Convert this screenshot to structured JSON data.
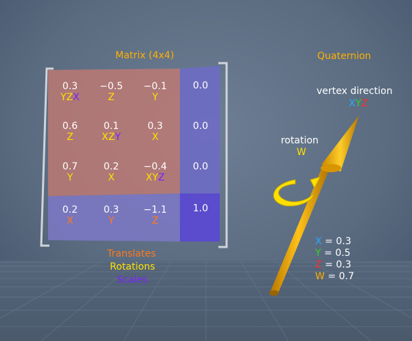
{
  "colors": {
    "x": "#ff7a1a",
    "y": "#ffe000",
    "z": "#7a22ff",
    "gold": "#ffb000",
    "cyan_x": "#2aa8ff",
    "green_y": "#36d12a",
    "red_z": "#ff2a2a"
  },
  "matrix": {
    "title": "Matrix (4x4)",
    "rows": [
      [
        {
          "value": "0.3",
          "axes": [
            {
              "t": "YZ",
              "c": "y"
            },
            {
              "t": "X",
              "c": "z"
            }
          ]
        },
        {
          "value": "−0.5",
          "axes": [
            {
              "t": "Z",
              "c": "y"
            }
          ]
        },
        {
          "value": "−0.1",
          "axes": [
            {
              "t": "Y",
              "c": "y"
            }
          ]
        }
      ],
      [
        {
          "value": "0.6",
          "axes": [
            {
              "t": "Z",
              "c": "y"
            }
          ]
        },
        {
          "value": "0.1",
          "axes": [
            {
              "t": "XZ",
              "c": "y"
            },
            {
              "t": "Y",
              "c": "z"
            }
          ]
        },
        {
          "value": "0.3",
          "axes": [
            {
              "t": "X",
              "c": "y"
            }
          ]
        }
      ],
      [
        {
          "value": "0.7",
          "axes": [
            {
              "t": "Y",
              "c": "y"
            }
          ]
        },
        {
          "value": "0.2",
          "axes": [
            {
              "t": "X",
              "c": "y"
            }
          ]
        },
        {
          "value": "−0.4",
          "axes": [
            {
              "t": "XY",
              "c": "y"
            },
            {
              "t": "Z",
              "c": "z"
            }
          ]
        }
      ],
      [
        {
          "value": "0.2",
          "axes": [
            {
              "t": "X",
              "c": "x"
            }
          ]
        },
        {
          "value": "0.3",
          "axes": [
            {
              "t": "Y",
              "c": "x"
            }
          ]
        },
        {
          "value": "−1.1",
          "axes": [
            {
              "t": "Z",
              "c": "x"
            }
          ]
        }
      ]
    ],
    "last_column": [
      "0.0",
      "0.0",
      "0.0",
      "1.0"
    ]
  },
  "legend": {
    "translates": "Translates",
    "rotations": "Rotations",
    "scales": "Scales"
  },
  "quaternion": {
    "title": "Quaternion",
    "vertex_direction_label": "vertex direction",
    "vertex_direction_axes": [
      {
        "t": "X",
        "c": "cyan_x"
      },
      {
        "t": "Y",
        "c": "green_y"
      },
      {
        "t": "Z",
        "c": "red_z"
      }
    ],
    "rotation_label": "rotation",
    "rotation_axis": "W",
    "values": [
      {
        "axis": "X",
        "c": "cyan_x",
        "text": " = 0.3"
      },
      {
        "axis": "Y",
        "c": "green_y",
        "text": " = 0.5"
      },
      {
        "axis": "Z",
        "c": "red_z",
        "text": " = 0.3"
      },
      {
        "axis": "W",
        "c": "gold",
        "text": " = 0.7"
      }
    ]
  }
}
